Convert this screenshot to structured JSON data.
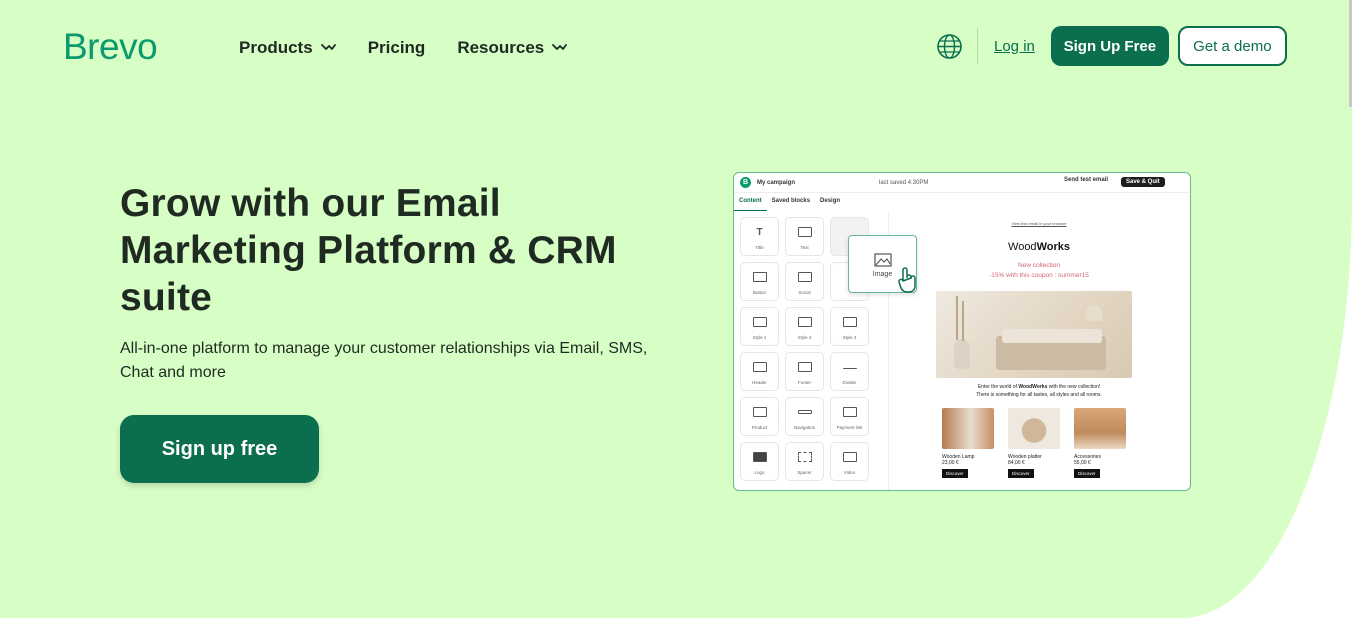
{
  "brand": {
    "logo_text": "Brevo",
    "color": "#0b996e"
  },
  "nav": {
    "items": [
      {
        "label": "Products",
        "has_dropdown": true
      },
      {
        "label": "Pricing",
        "has_dropdown": false
      },
      {
        "label": "Resources",
        "has_dropdown": true
      }
    ],
    "login_label": "Log in",
    "signup_label": "Sign Up Free",
    "demo_label": "Get a demo",
    "globe_icon": "globe-icon"
  },
  "hero": {
    "title": "Grow with our Email Marketing Platform & CRM suite",
    "subtitle": "All-in-one platform to manage your customer relationships via Email, SMS, Chat and more",
    "cta_label": "Sign up free",
    "background": "#d7fec5",
    "accent": "#0b6e4f"
  },
  "editor": {
    "campaign_name": "My campaign",
    "saved_text": "last saved 4:30PM",
    "send_test_label": "Send test email",
    "save_quit_label": "Save & Quit",
    "tabs": [
      "Content",
      "Saved blocks",
      "Design"
    ],
    "blocks": [
      "Title",
      "Text",
      "",
      "Button",
      "Social",
      "",
      "Style 1",
      "Style 2",
      "Style 3",
      "Header",
      "Footer",
      "Divider",
      "Product",
      "Navigation",
      "Payment link",
      "Logo",
      "Spacer",
      "Video"
    ],
    "drag_label": "Image",
    "email": {
      "view_browser": "View this email in your browser",
      "brand_light": "Wood",
      "brand_bold": "Works",
      "new_collection": "New collection",
      "coupon": "-15% with this coupon : summer15",
      "desc_line1_prefix": "Enter the world of ",
      "desc_line1_bold": "WoodWorks",
      "desc_line1_suffix": " with the new collection!",
      "desc_line2": "There is something for all tastes, all styles and all rooms.",
      "products": [
        {
          "name": "Wooden Lamp",
          "price": "23,00 €",
          "button": "Discover"
        },
        {
          "name": "Wooden platter",
          "price": "84,00 €",
          "button": "Discover"
        },
        {
          "name": "Accessories",
          "price": "55,00 €",
          "button": "Discover"
        }
      ]
    }
  }
}
